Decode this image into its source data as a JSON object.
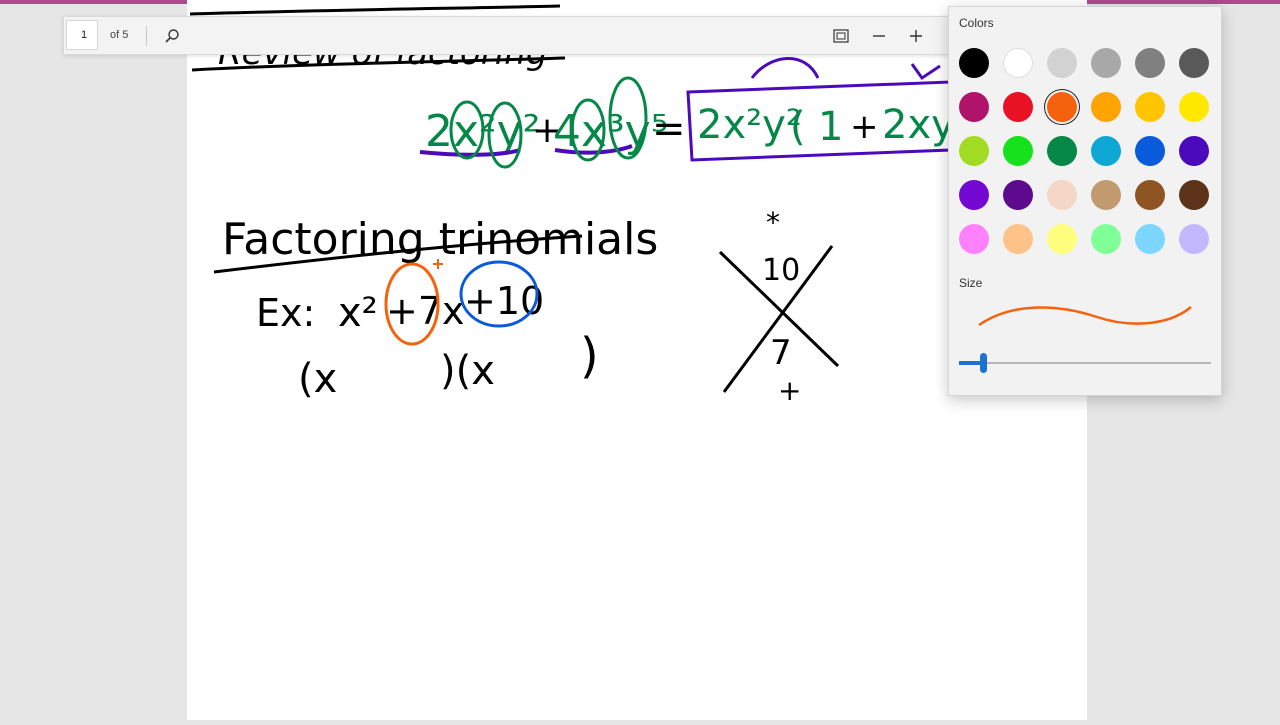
{
  "toolbar": {
    "page_current": "1",
    "page_total_label": "of 5",
    "icons": [
      "search-icon",
      "fit-page-icon",
      "minus-icon",
      "plus-icon"
    ]
  },
  "flyout": {
    "colors_title": "Colors",
    "size_title": "Size",
    "selected_color": "#f4620e",
    "accent": "#1a73d1",
    "stroke_size": 0.1,
    "swatches": [
      [
        "#000000",
        "#ffffff",
        "#d2d2d2",
        "#a8a8a8",
        "#808080",
        "#595959"
      ],
      [
        "#b0136a",
        "#e81224",
        "#f4620e",
        "#ffa400",
        "#ffc600",
        "#ffe800"
      ],
      [
        "#a2dc22",
        "#16e21b",
        "#058748",
        "#0ea7d4",
        "#0a5adc",
        "#4b0bbd"
      ],
      [
        "#7309d3",
        "#5e0a8e",
        "#f4d7c7",
        "#c19a70",
        "#8f5424",
        "#5c3318"
      ],
      [
        "#ff81ff",
        "#ffc38a",
        "#ffff7d",
        "#80ff98",
        "#7dd6ff",
        "#c3b8ff"
      ]
    ]
  },
  "ink": {
    "heading_review": "Review of factoring",
    "heading_factoring": "Factoring trinomials",
    "example_label": "Ex:",
    "example_terms": {
      "x2": "x²",
      "b": "+7x",
      "c": "+10"
    },
    "binomial_left": "(x",
    "binomial_right": ")(x",
    "binomial_close": ")",
    "gcf_terms": {
      "t1": "2x²y²",
      "plus": "+",
      "t2": "4x³y⁵",
      "eq": "=",
      "gcf": "2x²y²",
      "open": "(",
      "one": "1",
      "plus2": "+",
      "t3": "2xy"
    },
    "x_product_label": "*",
    "x_product": "10",
    "x_sum": "7",
    "x_sum_label": "+"
  }
}
